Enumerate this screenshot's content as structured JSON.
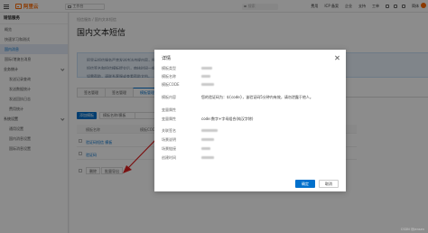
{
  "topbar": {
    "brand": "阿里云",
    "workspace": "工作台",
    "search_placeholder": "搜索",
    "links": [
      "费用",
      "ICP 备案",
      "企业",
      "支持",
      "工单"
    ],
    "lang": "简体"
  },
  "sidebar": {
    "title": "短信服务",
    "items": [
      {
        "label": "概览",
        "sub": false,
        "active": false
      },
      {
        "label": "快速学习和测试",
        "sub": false,
        "active": false
      },
      {
        "label": "国内消息",
        "sub": false,
        "active": true
      },
      {
        "label": "国际/港澳台消息",
        "sub": false,
        "active": false
      }
    ],
    "group1": "业务统计",
    "group1_items": [
      "发送记录查询",
      "发送数据统计",
      "发送回执日志",
      "费用统计"
    ],
    "group2": "系统设置",
    "group2_items": [
      "通用设置",
      "国内消息设置",
      "国际消息设置"
    ]
  },
  "main": {
    "breadcrumb": "短信服务 / 国内文本短信",
    "title": "国内文本短信",
    "alert_lines": [
      "阿里云短信服务严禁发送违法违规内容，所有短信须经审核后方可发送。",
      "短信签名和短信模板提交后，审核时间一般为2小时，政企客户请提交资质以加快审核。",
      "如需帮助，请联系客服或查看帮助文档。"
    ],
    "tabs": [
      "签名管理",
      "签名管理",
      "模板管理"
    ],
    "add_button": "添加模板",
    "filter_select": "模板名称/模板",
    "table_headers": [
      "模板名称",
      "模板CODE",
      "模板类型",
      "创建时间",
      "状态",
      "操作"
    ],
    "rows": [
      {
        "name": "验证码短信 模板",
        "time": "2023-10-11 15:54:29",
        "status": "通过",
        "action": "详情"
      },
      {
        "name": "验证码",
        "time": "2023-10-11 15:54:26",
        "status": "通过",
        "action": "详情"
      }
    ],
    "bottom_buttons": [
      "删除",
      "批量导出"
    ]
  },
  "modal": {
    "title": "详情",
    "fields": [
      {
        "label": "模板类型",
        "value": "",
        "blurred": true
      },
      {
        "label": "模板名称",
        "value": "",
        "blurred": true
      },
      {
        "label": "模板CODE",
        "value": "",
        "blurred": true
      },
      {
        "label": "模板内容",
        "value": "您的验证码为：${code}，该验证码5分钟内有效，请勿泄露于他人。",
        "blurred": false
      },
      {
        "label": "变量属性",
        "value": "",
        "blurred": false
      },
      {
        "label": "变量属性",
        "value": "code:数字+字母组合(纯汉字除)",
        "blurred": false
      },
      {
        "label": "关联签名",
        "value": "",
        "blurred": true
      },
      {
        "label": "场景说明",
        "value": "",
        "blurred": true
      },
      {
        "label": "场景链接",
        "value": "",
        "blurred": true
      },
      {
        "label": "创建时间",
        "value": "",
        "blurred": true
      }
    ],
    "ok_label": "确定",
    "cancel_label": "取消"
  },
  "colors": {
    "brand": "#ff6a00",
    "primary": "#0070cc",
    "success": "#1e9b4c"
  },
  "watermark": "CSDN @Jensen"
}
